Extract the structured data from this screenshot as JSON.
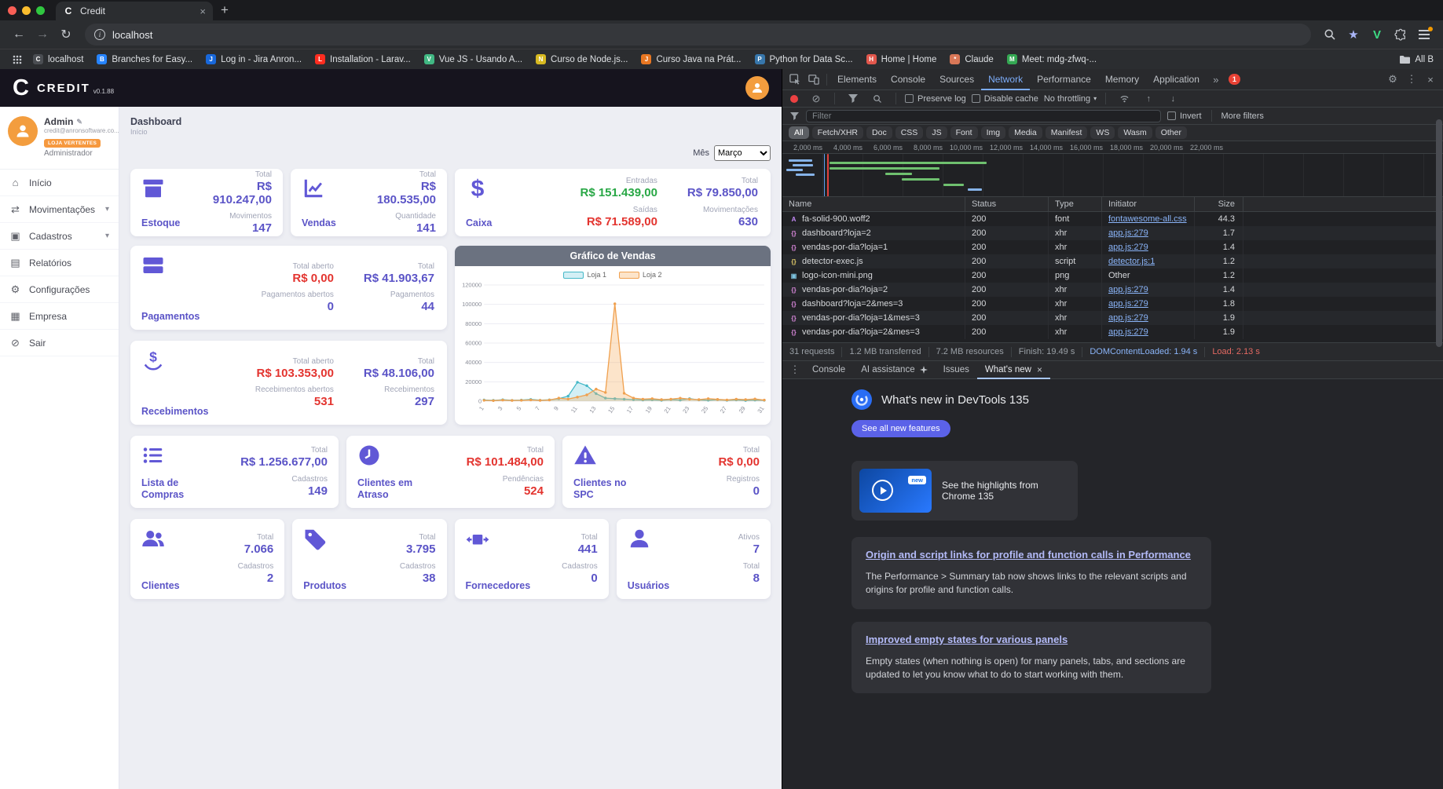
{
  "browser": {
    "tab": {
      "title": "Credit",
      "favicon": "C"
    },
    "url": "localhost",
    "bookmarks": [
      {
        "label": "localhost",
        "letter": "C",
        "color": "#4a4d52"
      },
      {
        "label": "Branches for Easy...",
        "letter": "B",
        "color": "#2684ff"
      },
      {
        "label": "Log in - Jira Anron...",
        "letter": "J",
        "color": "#1868db"
      },
      {
        "label": "Installation - Larav...",
        "letter": "L",
        "color": "#ff2d20"
      },
      {
        "label": "Vue JS - Usando A...",
        "letter": "V",
        "color": "#41b883"
      },
      {
        "label": "Curso de Node.js...",
        "letter": "N",
        "color": "#d7b921"
      },
      {
        "label": "Curso Java na Prát...",
        "letter": "J",
        "color": "#e87722"
      },
      {
        "label": "Python for Data Sc...",
        "letter": "P",
        "color": "#3776ab"
      },
      {
        "label": "Home | Home",
        "letter": "H",
        "color": "#e2574c"
      },
      {
        "label": "Claude",
        "letter": "*",
        "color": "#d97757"
      },
      {
        "label": "Meet: mdg-zfwq-...",
        "letter": "M",
        "color": "#34a853"
      }
    ],
    "all_bookmarks": "All B"
  },
  "app": {
    "logo_letter": "C",
    "brand": "CREDIT",
    "version": "v0.1.88",
    "user": {
      "name": "Admin",
      "email": "credit@anronsoftware.co...",
      "badge": "LOJA VERTENTES",
      "role": "Administrador"
    },
    "menu": [
      {
        "id": "inicio",
        "label": "Início",
        "icon": "home"
      },
      {
        "id": "movimentacoes",
        "label": "Movimentações",
        "icon": "exchange",
        "chevron": true
      },
      {
        "id": "cadastros",
        "label": "Cadastros",
        "icon": "folder",
        "chevron": true
      },
      {
        "id": "relatorios",
        "label": "Relatórios",
        "icon": "report"
      },
      {
        "id": "configuracoes",
        "label": "Configurações",
        "icon": "gear"
      },
      {
        "id": "empresa",
        "label": "Empresa",
        "icon": "building"
      },
      {
        "id": "sair",
        "label": "Sair",
        "icon": "power"
      }
    ],
    "page": {
      "title": "Dashboard",
      "subtitle": "Início"
    },
    "month": {
      "label": "Mês",
      "value": "Março"
    },
    "cards": {
      "estoque": {
        "label": "Estoque",
        "g1k": "Total",
        "g1v": "R$ 910.247,00",
        "g2k": "Movimentos",
        "g2v": "147"
      },
      "vendas": {
        "label": "Vendas",
        "g1k": "Total",
        "g1v": "R$ 180.535,00",
        "g2k": "Quantidade",
        "g2v": "141"
      },
      "caixa": {
        "label": "Caixa",
        "a1k": "Entradas",
        "a1v": "R$ 151.439,00",
        "a2k": "Saídas",
        "a2v": "R$ 71.589,00",
        "b1k": "Total",
        "b1v": "R$ 79.850,00",
        "b2k": "Movimentações",
        "b2v": "630"
      },
      "pagamentos": {
        "label": "Pagamentos",
        "a1k": "Total aberto",
        "a1v": "R$ 0,00",
        "a2k": "Pagamentos abertos",
        "a2v": "0",
        "b1k": "Total",
        "b1v": "R$ 41.903,67",
        "b2k": "Pagamentos",
        "b2v": "44"
      },
      "recebimentos": {
        "label": "Recebimentos",
        "a1k": "Total aberto",
        "a1v": "R$ 103.353,00",
        "a2k": "Recebimentos abertos",
        "a2v": "531",
        "b1k": "Total",
        "b1v": "R$ 48.106,00",
        "b2k": "Recebimentos",
        "b2v": "297"
      },
      "lista_compras": {
        "label": "Lista de Compras",
        "g1k": "Total",
        "g1v": "R$ 1.256.677,00",
        "g2k": "Cadastros",
        "g2v": "149"
      },
      "clientes_atraso": {
        "label": "Clientes em Atraso",
        "g1k": "Total",
        "g1v": "R$ 101.484,00",
        "g2k": "Pendências",
        "g2v": "524"
      },
      "clientes_spc": {
        "label": "Clientes no SPC",
        "g1k": "Total",
        "g1v": "R$ 0,00",
        "g2k": "Registros",
        "g2v": "0"
      },
      "clientes": {
        "label": "Clientes",
        "g1k": "Total",
        "g1v": "7.066",
        "g2k": "Cadastros",
        "g2v": "2"
      },
      "produtos": {
        "label": "Produtos",
        "g1k": "Total",
        "g1v": "3.795",
        "g2k": "Cadastros",
        "g2v": "38"
      },
      "fornecedores": {
        "label": "Fornecedores",
        "g1k": "Total",
        "g1v": "441",
        "g2k": "Cadastros",
        "g2v": "0"
      },
      "usuarios": {
        "label": "Usuários",
        "g1k": "Ativos",
        "g1v": "7",
        "g2k": "Total",
        "g2v": "8"
      }
    }
  },
  "chart_data": {
    "type": "line",
    "title": "Gráfico de Vendas",
    "x": [
      1,
      2,
      3,
      4,
      5,
      6,
      7,
      8,
      9,
      10,
      11,
      12,
      13,
      14,
      15,
      16,
      17,
      18,
      19,
      20,
      21,
      22,
      23,
      24,
      25,
      26,
      27,
      28,
      29,
      30,
      31
    ],
    "ylim": [
      0,
      120000
    ],
    "yticks": [
      0,
      20000,
      40000,
      60000,
      80000,
      100000,
      120000
    ],
    "legend_position": "top",
    "series": [
      {
        "name": "Loja 1",
        "color": "#45b8c8",
        "fill": "rgba(130,210,225,0.35)",
        "values": [
          1200,
          800,
          1500,
          900,
          1100,
          1800,
          1000,
          1400,
          2600,
          5200,
          19500,
          16000,
          7800,
          3200,
          2600,
          2100,
          1600,
          1200,
          1500,
          900,
          1700,
          1100,
          2600,
          1300,
          1000,
          1600,
          900,
          1300,
          700,
          1100,
          900
        ]
      },
      {
        "name": "Loja 2",
        "color": "#f0a04e",
        "fill": "rgba(247,178,103,0.35)",
        "values": [
          900,
          600,
          1100,
          700,
          900,
          1300,
          800,
          1200,
          3200,
          2200,
          4200,
          6500,
          12500,
          9000,
          100500,
          8200,
          3200,
          2100,
          2600,
          1600,
          2100,
          3100,
          2100,
          1600,
          2600,
          1900,
          1300,
          2100,
          1600,
          2300,
          1100
        ]
      }
    ]
  },
  "devtools": {
    "tabs": [
      "Elements",
      "Console",
      "Sources",
      "Network",
      "Performance",
      "Memory",
      "Application"
    ],
    "active_tab": "Network",
    "error_badge": "1",
    "network": {
      "toolbar": {
        "preserve_log": "Preserve log",
        "disable_cache": "Disable cache",
        "throttling": "No throttling"
      },
      "filter": {
        "placeholder": "Filter",
        "invert": "Invert",
        "more": "More filters"
      },
      "chips": [
        "All",
        "Fetch/XHR",
        "Doc",
        "CSS",
        "JS",
        "Font",
        "Img",
        "Media",
        "Manifest",
        "WS",
        "Wasm",
        "Other"
      ],
      "active_chip": "All",
      "ruler": [
        "2,000 ms",
        "4,000 ms",
        "6,000 ms",
        "8,000 ms",
        "10,000 ms",
        "12,000 ms",
        "14,000 ms",
        "16,000 ms",
        "18,000 ms",
        "20,000 ms",
        "22,000 ms"
      ],
      "columns": [
        "Name",
        "Status",
        "Type",
        "Initiator",
        "Size"
      ],
      "rows": [
        {
          "name": "fa-solid-900.woff2",
          "status": "200",
          "type": "font",
          "initiator": "fontawesome-all.css",
          "initiator_link": true,
          "size": "44.3",
          "icon": "font"
        },
        {
          "name": "dashboard?loja=2",
          "status": "200",
          "type": "xhr",
          "initiator": "app.js:279",
          "initiator_link": true,
          "size": "1.7",
          "icon": "xhr"
        },
        {
          "name": "vendas-por-dia?loja=1",
          "status": "200",
          "type": "xhr",
          "initiator": "app.js:279",
          "initiator_link": true,
          "size": "1.4",
          "icon": "xhr"
        },
        {
          "name": "detector-exec.js",
          "status": "200",
          "type": "script",
          "initiator": "detector.js:1",
          "initiator_link": true,
          "size": "1.2",
          "icon": "script"
        },
        {
          "name": "logo-icon-mini.png",
          "status": "200",
          "type": "png",
          "initiator": "Other",
          "initiator_link": false,
          "size": "1.2",
          "icon": "img"
        },
        {
          "name": "vendas-por-dia?loja=2",
          "status": "200",
          "type": "xhr",
          "initiator": "app.js:279",
          "initiator_link": true,
          "size": "1.4",
          "icon": "xhr"
        },
        {
          "name": "dashboard?loja=2&mes=3",
          "status": "200",
          "type": "xhr",
          "initiator": "app.js:279",
          "initiator_link": true,
          "size": "1.8",
          "icon": "xhr"
        },
        {
          "name": "vendas-por-dia?loja=1&mes=3",
          "status": "200",
          "type": "xhr",
          "initiator": "app.js:279",
          "initiator_link": true,
          "size": "1.9",
          "icon": "xhr"
        },
        {
          "name": "vendas-por-dia?loja=2&mes=3",
          "status": "200",
          "type": "xhr",
          "initiator": "app.js:279",
          "initiator_link": true,
          "size": "1.9",
          "icon": "xhr"
        }
      ],
      "summary": {
        "requests": "31 requests",
        "transferred": "1.2 MB transferred",
        "resources": "7.2 MB resources",
        "finish": "Finish: 19.49 s",
        "dcl": "DOMContentLoaded: 1.94 s",
        "load": "Load: 2.13 s"
      }
    },
    "drawer": {
      "tabs": [
        "Console",
        "AI assistance",
        "Issues",
        "What's new"
      ],
      "active": "What's new"
    },
    "whats_new": {
      "title": "What's new in DevTools 135",
      "button": "See all new features",
      "highlight_badge": "new",
      "highlight_text": "See the highlights from Chrome 135",
      "articles": [
        {
          "heading": "Origin and script links for profile and function calls in Performance",
          "body": "The Performance > Summary tab now shows links to the relevant scripts and origins for profile and function calls."
        },
        {
          "heading": "Improved empty states for various panels",
          "body": "Empty states (when nothing is open) for many panels, tabs, and sections are updated to let you know what to do to start working with them."
        }
      ]
    }
  }
}
